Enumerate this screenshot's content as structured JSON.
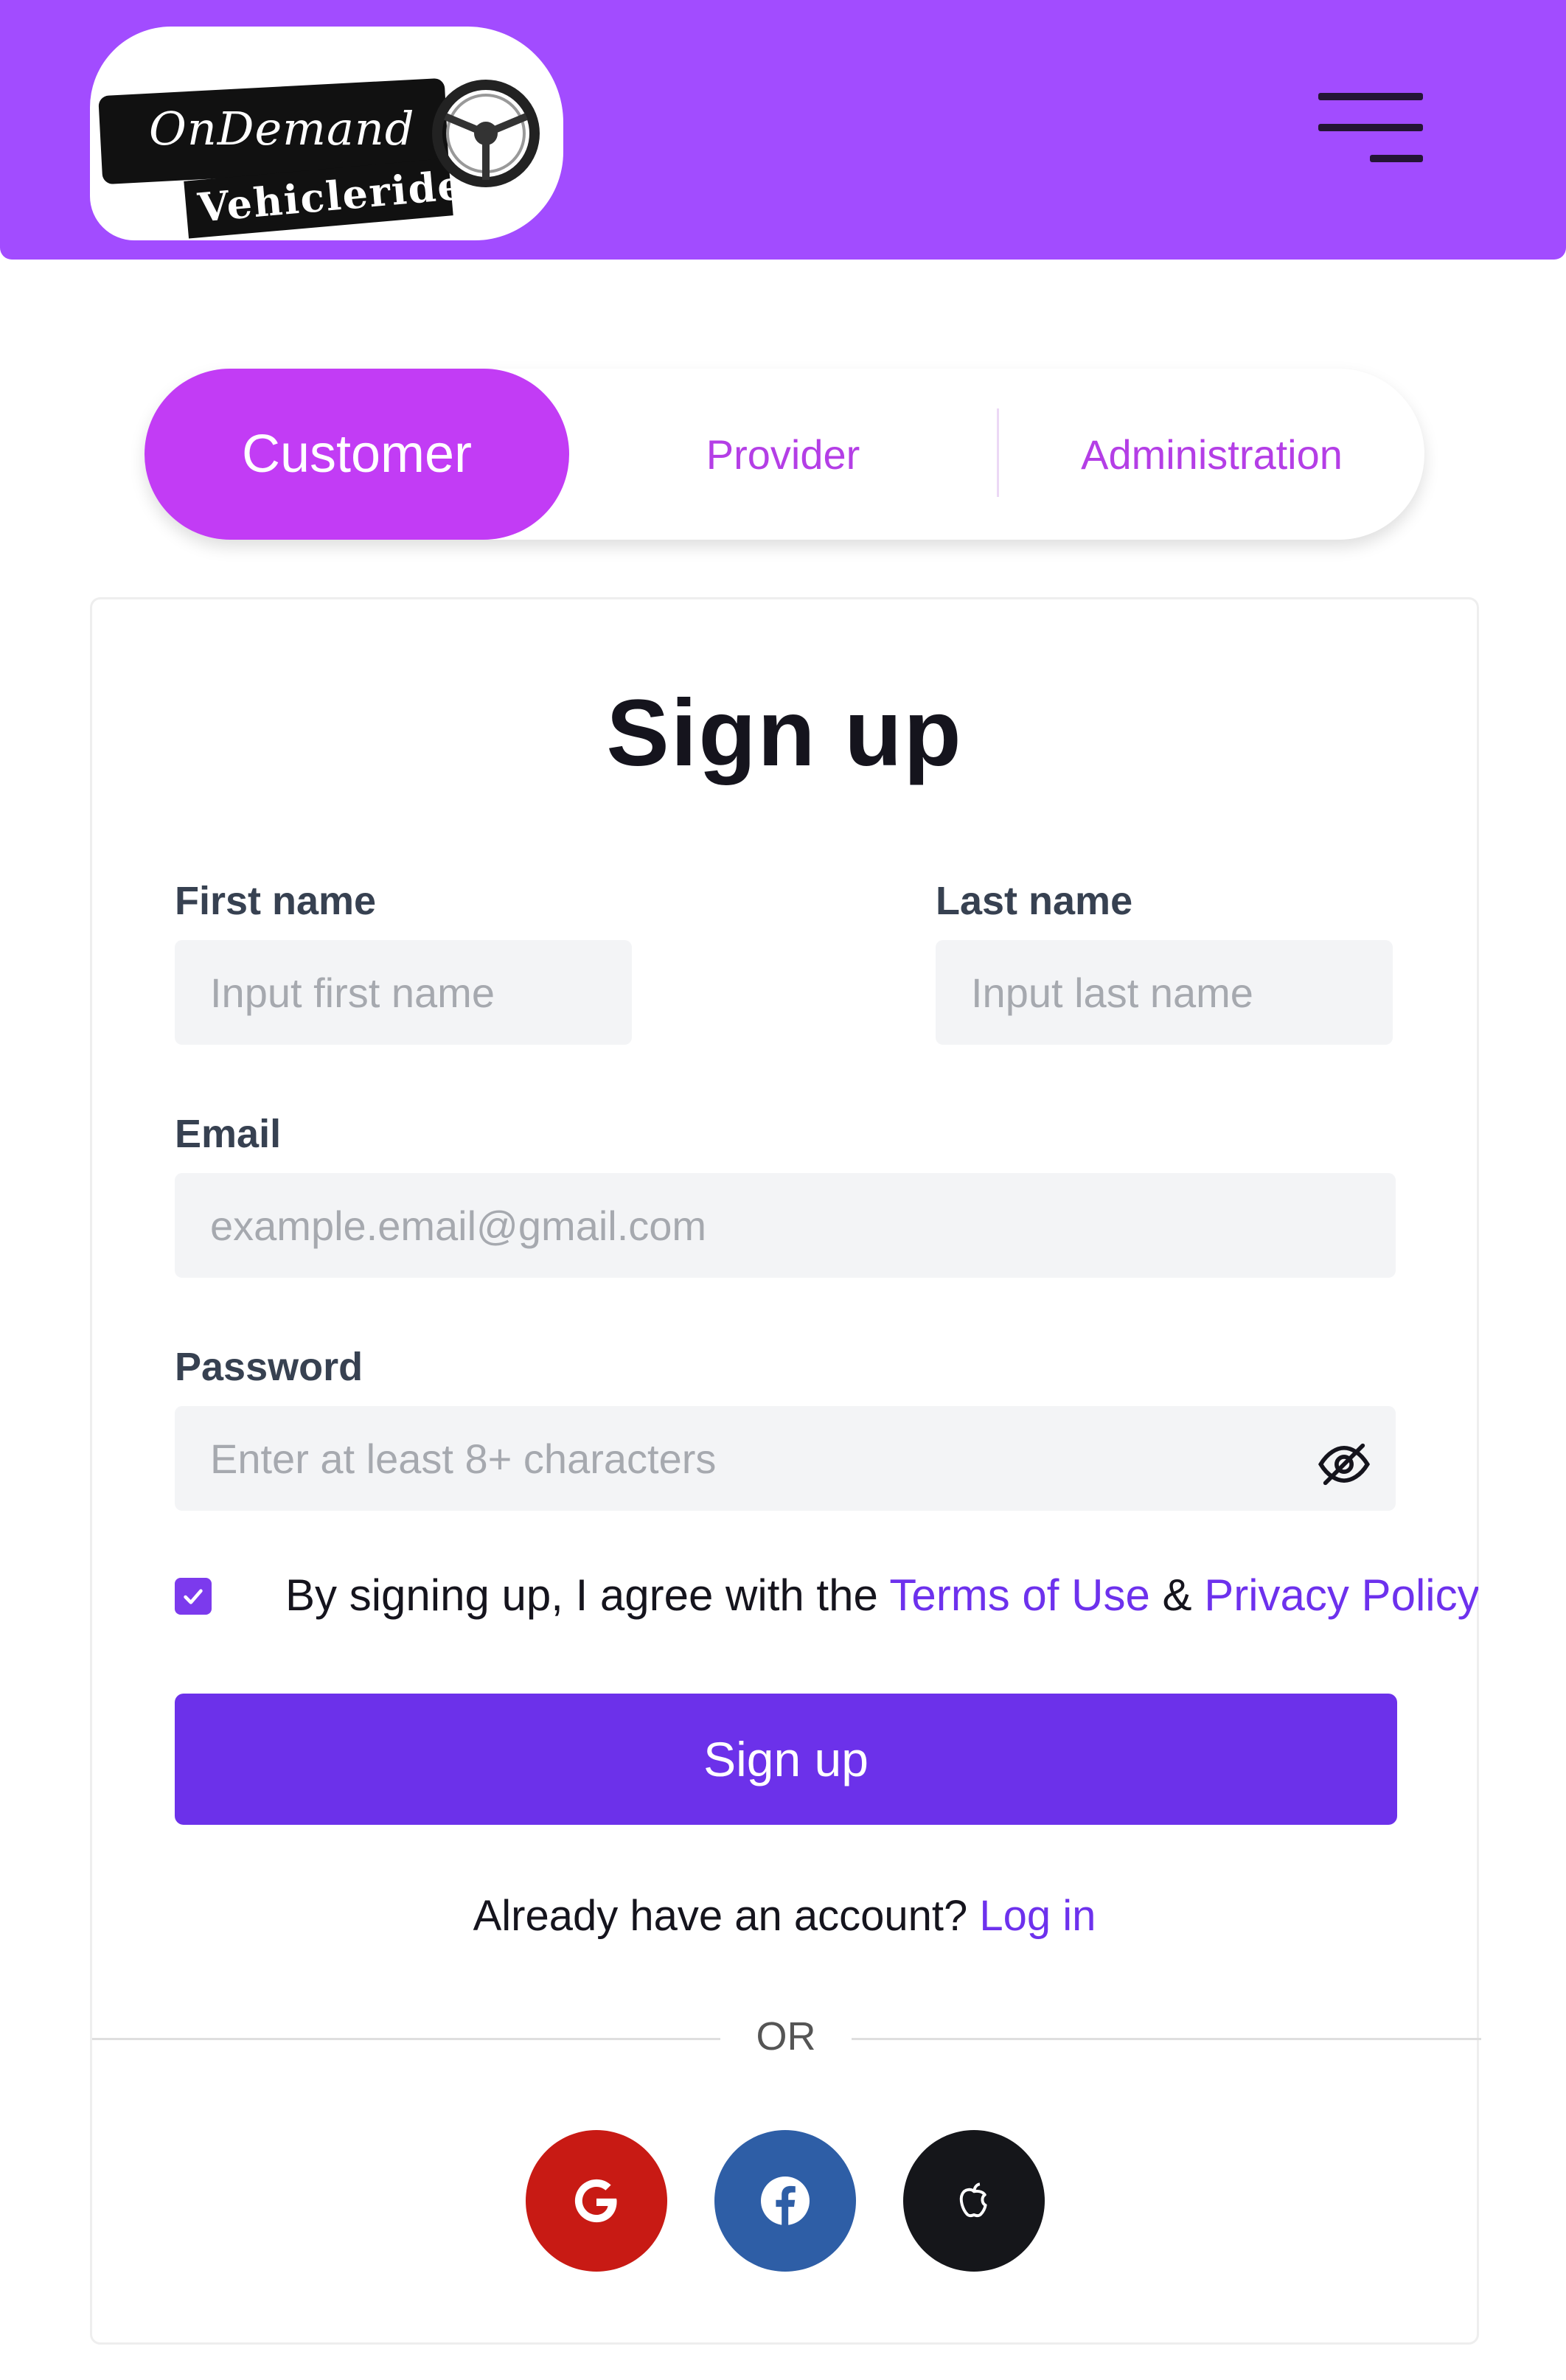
{
  "brand": {
    "line1": "OnDemand",
    "line2": "Vehicleride",
    "header_color": "#a24cff"
  },
  "header": {
    "menu_icon": "hamburger-menu-icon"
  },
  "tabs": [
    {
      "label": "Customer",
      "active": true
    },
    {
      "label": "Provider",
      "active": false
    },
    {
      "label": "Administration",
      "active": false
    }
  ],
  "form": {
    "title": "Sign up",
    "first_name": {
      "label": "First name",
      "placeholder": "Input first name",
      "value": ""
    },
    "last_name": {
      "label": "Last name",
      "placeholder": "Input last name",
      "value": ""
    },
    "email": {
      "label": "Email",
      "placeholder": "example.email@gmail.com",
      "value": ""
    },
    "password": {
      "label": "Password",
      "placeholder": "Enter at least 8+ characters",
      "value": "",
      "toggle_icon": "eye-off-icon"
    },
    "agreement": {
      "checked": true,
      "prefix": "By signing up, I agree with the ",
      "terms": "Terms of Use",
      "amp": " & ",
      "privacy": "Privacy Policy"
    },
    "submit_label": "Sign up",
    "login_prompt": "Already have an account? ",
    "login_link": "Log in",
    "divider_label": "OR"
  },
  "social": [
    {
      "name": "google",
      "icon": "google-icon",
      "color": "#c81a14"
    },
    {
      "name": "facebook",
      "icon": "facebook-icon",
      "color": "#2e5ea6"
    },
    {
      "name": "apple",
      "icon": "apple-icon",
      "color": "#15161a"
    }
  ],
  "colors": {
    "accent": "#6c31ea",
    "tab_active": "#c23cf5",
    "tab_text": "#b43ee6"
  }
}
